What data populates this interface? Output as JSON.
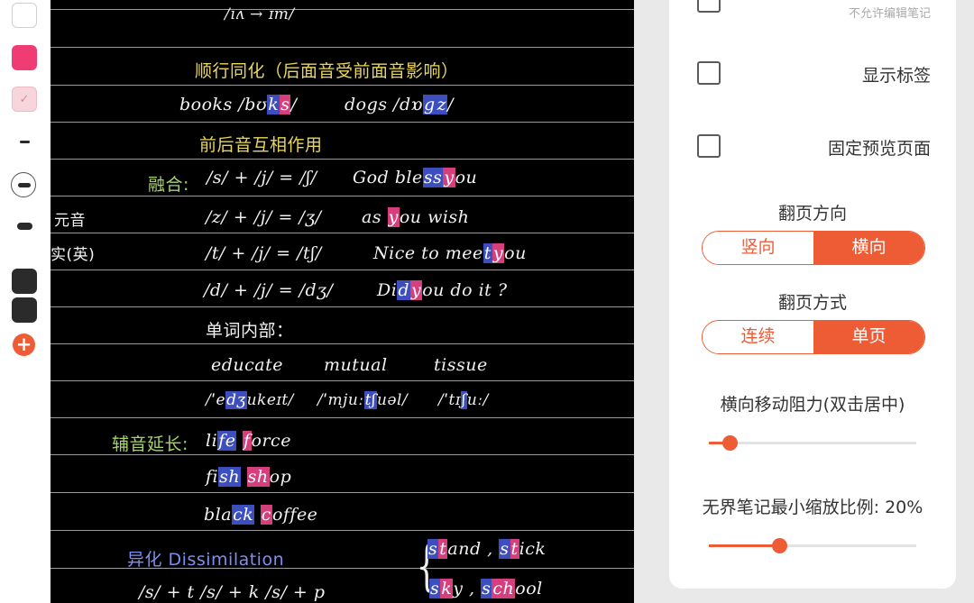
{
  "toolbar": {
    "colors": {
      "white": "#ffffff",
      "pink": "#ef3c73",
      "light_pink": "#f6d6dc",
      "dark": "#2b2b2b",
      "accent": "#ee5c36"
    },
    "check_glyph": "✓",
    "add_glyph": "+"
  },
  "note": {
    "line0": "/ıʌ → ɪm/",
    "assim_title": "顺行同化（后面音受前面音影响）",
    "books": "books /bʊ",
    "books_k": "k",
    "books_s": "s",
    "books_end": "/",
    "dogs": "dogs /dɒ",
    "dogs_g": "g",
    "dogs_z": "z",
    "dogs_end": "/",
    "mutual_title": "前后音互相作用",
    "fusion_label": "融合:",
    "r1_formula": "/s/ + /j/ = /ʃ/",
    "r1_ex_a": "God ble",
    "r1_ex_hb": "ss",
    "r1_ex_hp": "y",
    "r1_ex_b": "ou",
    "side_a": "元音",
    "r2_formula": "/z/ + /j/ = /ʒ/",
    "r2_ex_a": "as ",
    "r2_ex_hp": "y",
    "r2_ex_b": "ou wish",
    "side_b": "实(英)",
    "r3_formula": "/t/ + /j/ = /tʃ/",
    "r3_ex_a": "Nice to mee",
    "r3_ex_hb": "t",
    "r3_ex_hp": "y",
    "r3_ex_b": "ou",
    "r4_formula": "/d/ + /j/ = /dʒ/",
    "r4_ex_a": "Di",
    "r4_ex_hb": "d",
    "r4_ex_hp": "y",
    "r4_ex_b": "ou do it ?",
    "inner_title": "单词内部：",
    "w1": "educate",
    "w2": "mutual",
    "w3": "tissue",
    "ipa1_a": "/ˈe",
    "ipa1_hb": "dʒ",
    "ipa1_b": "ukeɪt/",
    "ipa2_a": "/ˈmjuː",
    "ipa2_hb": "tʃ",
    "ipa2_b": "uəl/",
    "ipa3_a": "/ˈtɪ",
    "ipa3_hb": "ʃ",
    "ipa3_b": "uː/",
    "length_label": "辅音延长:",
    "life_a": "li",
    "life_hb": "fe",
    "life_sp": " ",
    "force_hp": "f",
    "force_b": "orce",
    "fish_a": "fi",
    "fish_hb": "sh",
    "fish_sp": " ",
    "shop_hp": "sh",
    "shop_b": "op",
    "black_a": "bla",
    "black_hb": "ck",
    "black_sp": " ",
    "coffee_hp": "c",
    "coffee_b": "offee",
    "dissim_title": "异化  Dissimilation",
    "stand_hb": "s",
    "stand_hp": "t",
    "stand_b": "and , ",
    "stick_hb": "s",
    "stick_hp": "t",
    "stick_b": "ick",
    "sky_hb": "s",
    "sky_hp": "k",
    "sky_b": "y , ",
    "school_hb": "s",
    "school_hp": "ch",
    "school_b": "ool",
    "bottom_formula": "/s/ + t    /s/ + k    /s/ + p",
    "brace": "{"
  },
  "settings": {
    "no_edit_sub": "不允许编辑笔记",
    "show_tags_label": "显示标签",
    "fix_preview_label": "固定预览页面",
    "page_turn_direction_title": "翻页方向",
    "direction_vertical": "竖向",
    "direction_horizontal": "横向",
    "direction_selected": "横向",
    "page_turn_mode_title": "翻页方式",
    "mode_continuous": "连续",
    "mode_single": "单页",
    "mode_selected": "单页",
    "horizontal_resistance_title": "横向移动阻力(双击居中)",
    "horizontal_resistance_value": 0.1,
    "min_zoom_title": "无界笔记最小缩放比例: 20%",
    "min_zoom_value": 0.34
  }
}
